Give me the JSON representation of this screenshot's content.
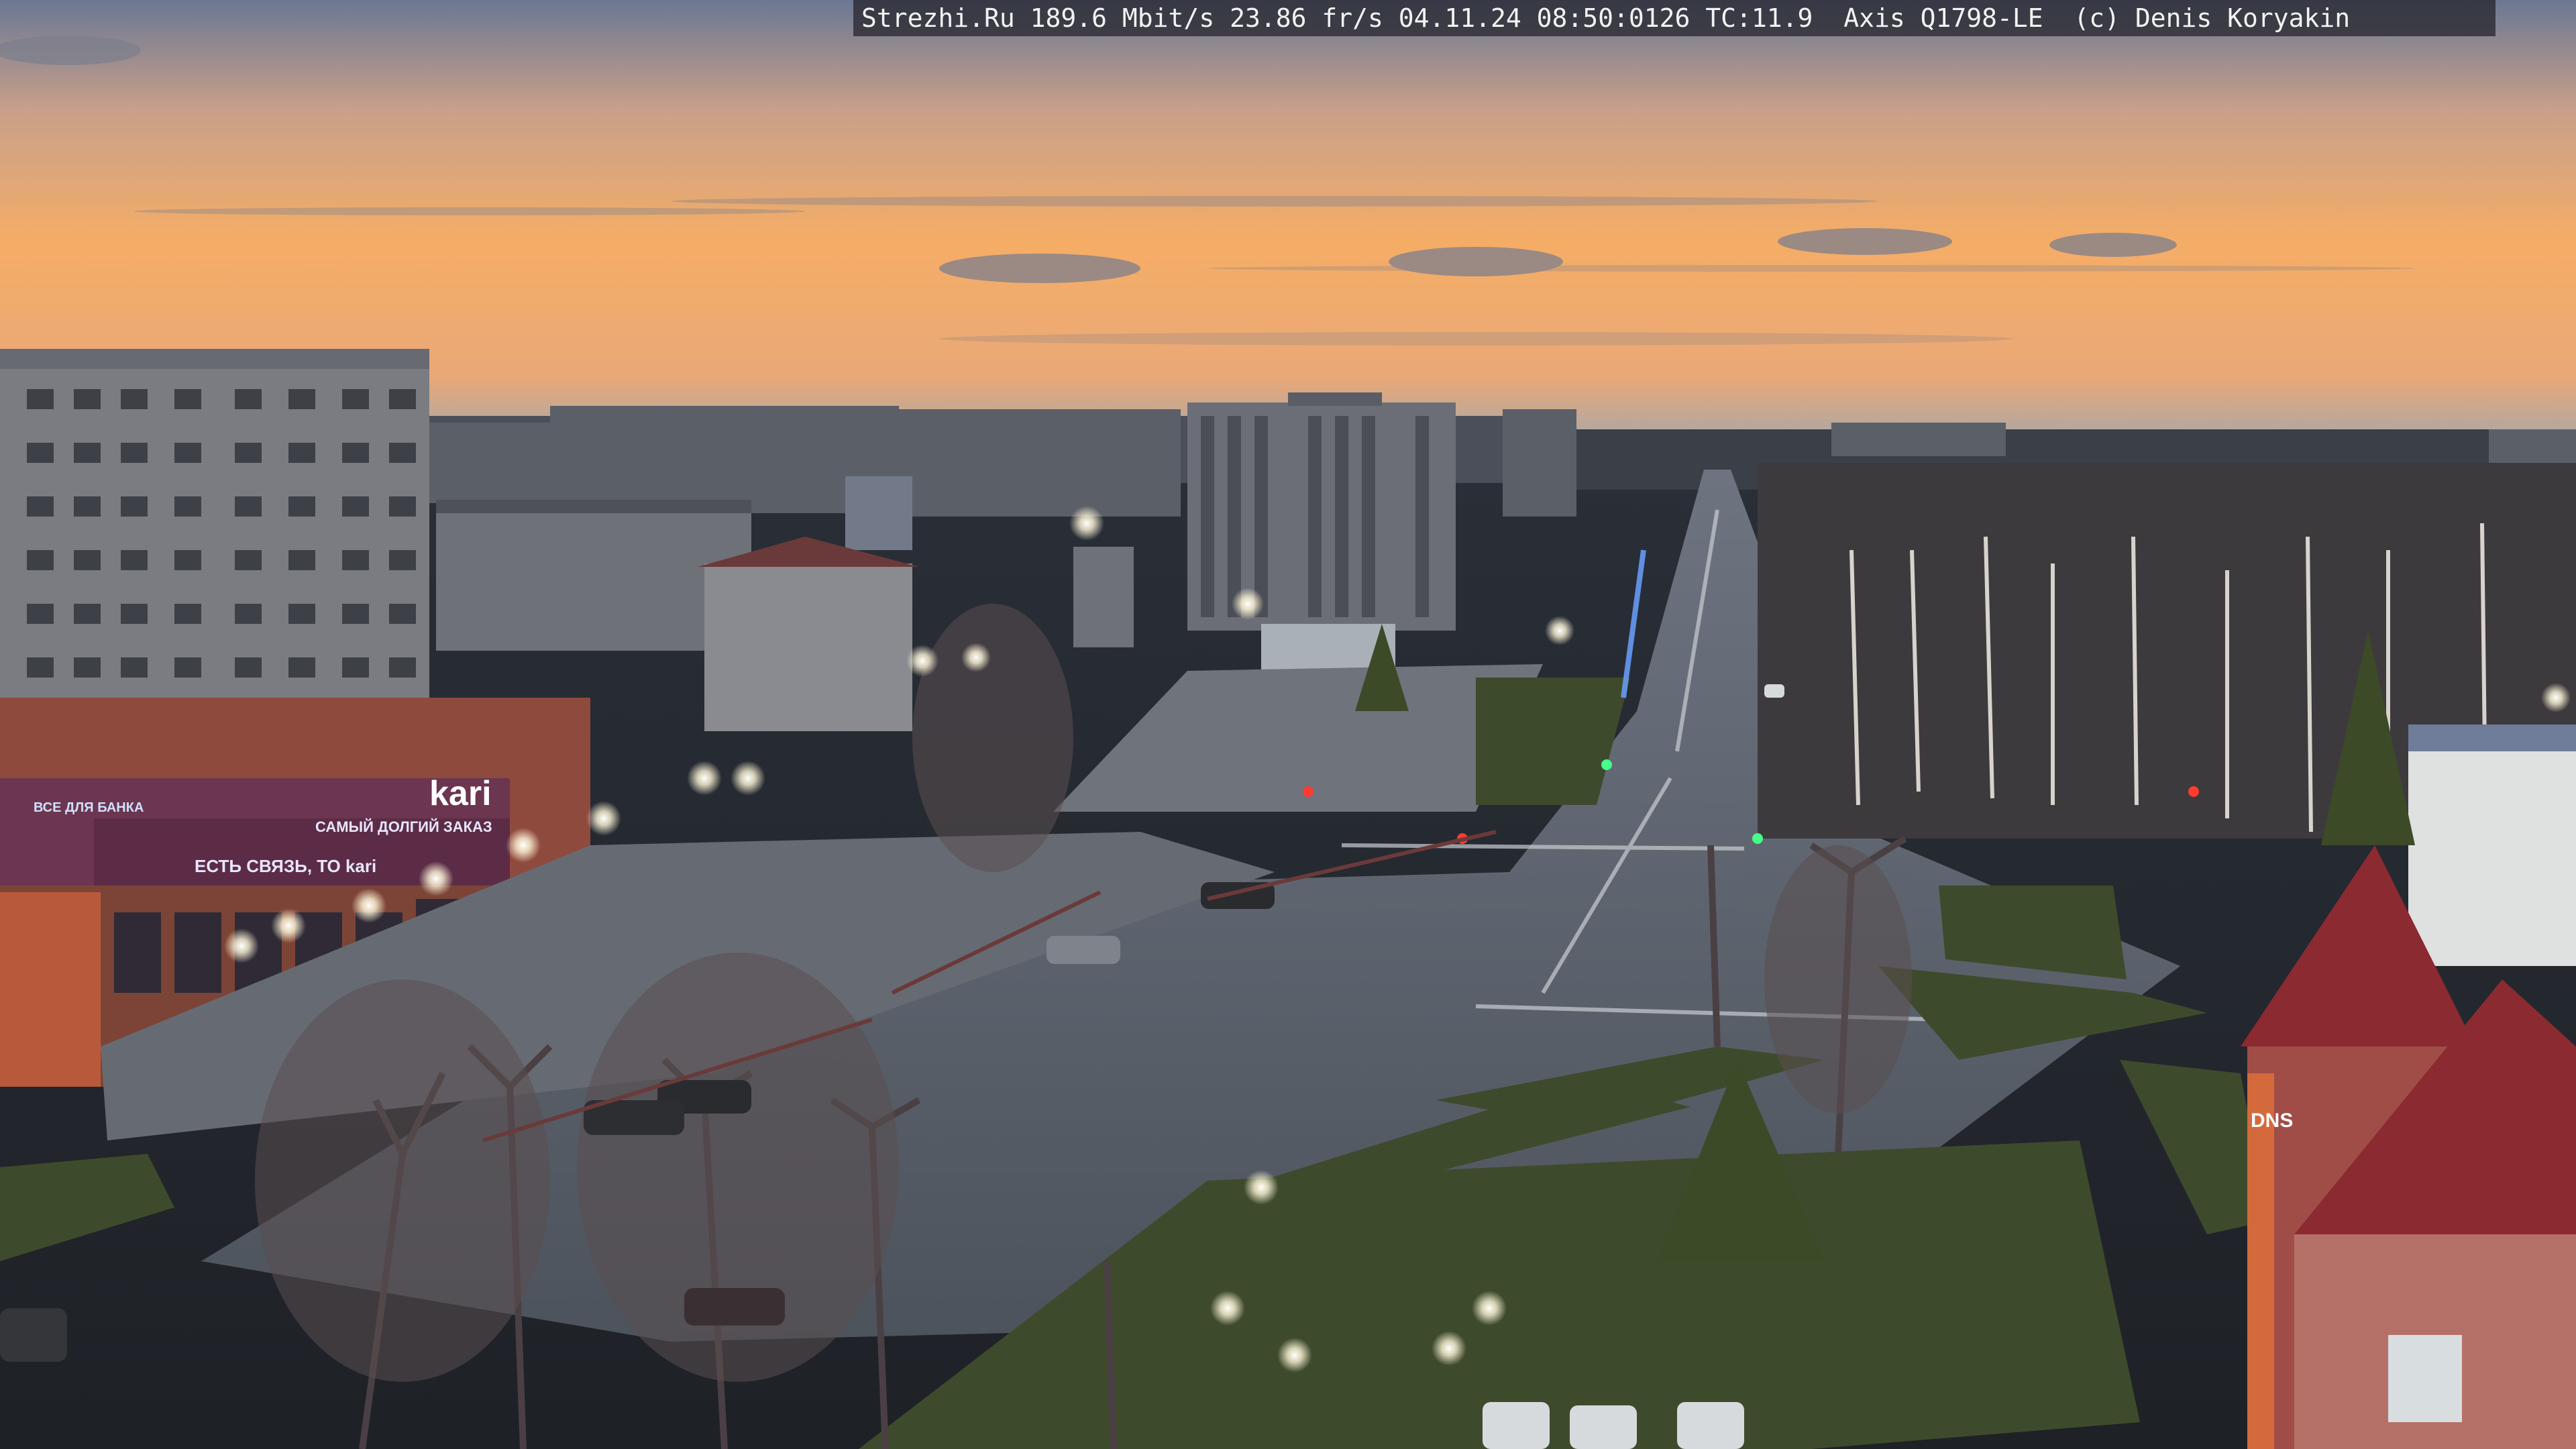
{
  "camera_overlay": {
    "text": "Strezhi.Ru 189.6 Mbit/s 23.86 fr/s 04.11.24 08:50:0126 TC:11.9  Axis Q1798-LE  (c) Denis Koryakin"
  },
  "signs": {
    "store_brand": "kari",
    "store_slogan": "ЕСТЬ СВЯЗЬ, ТО kari",
    "store_promo": "САМЫЙ ДОЛГИЙ ЗАКАЗ",
    "bank_sign": "ВСЕ ДЛЯ БАНКА",
    "building_sign": "DNS"
  },
  "colors": {
    "sky_top": "#5f6f8a",
    "sky_glow": "#f4a860",
    "road": "#5a6068",
    "grass": "#3c4a2e"
  }
}
